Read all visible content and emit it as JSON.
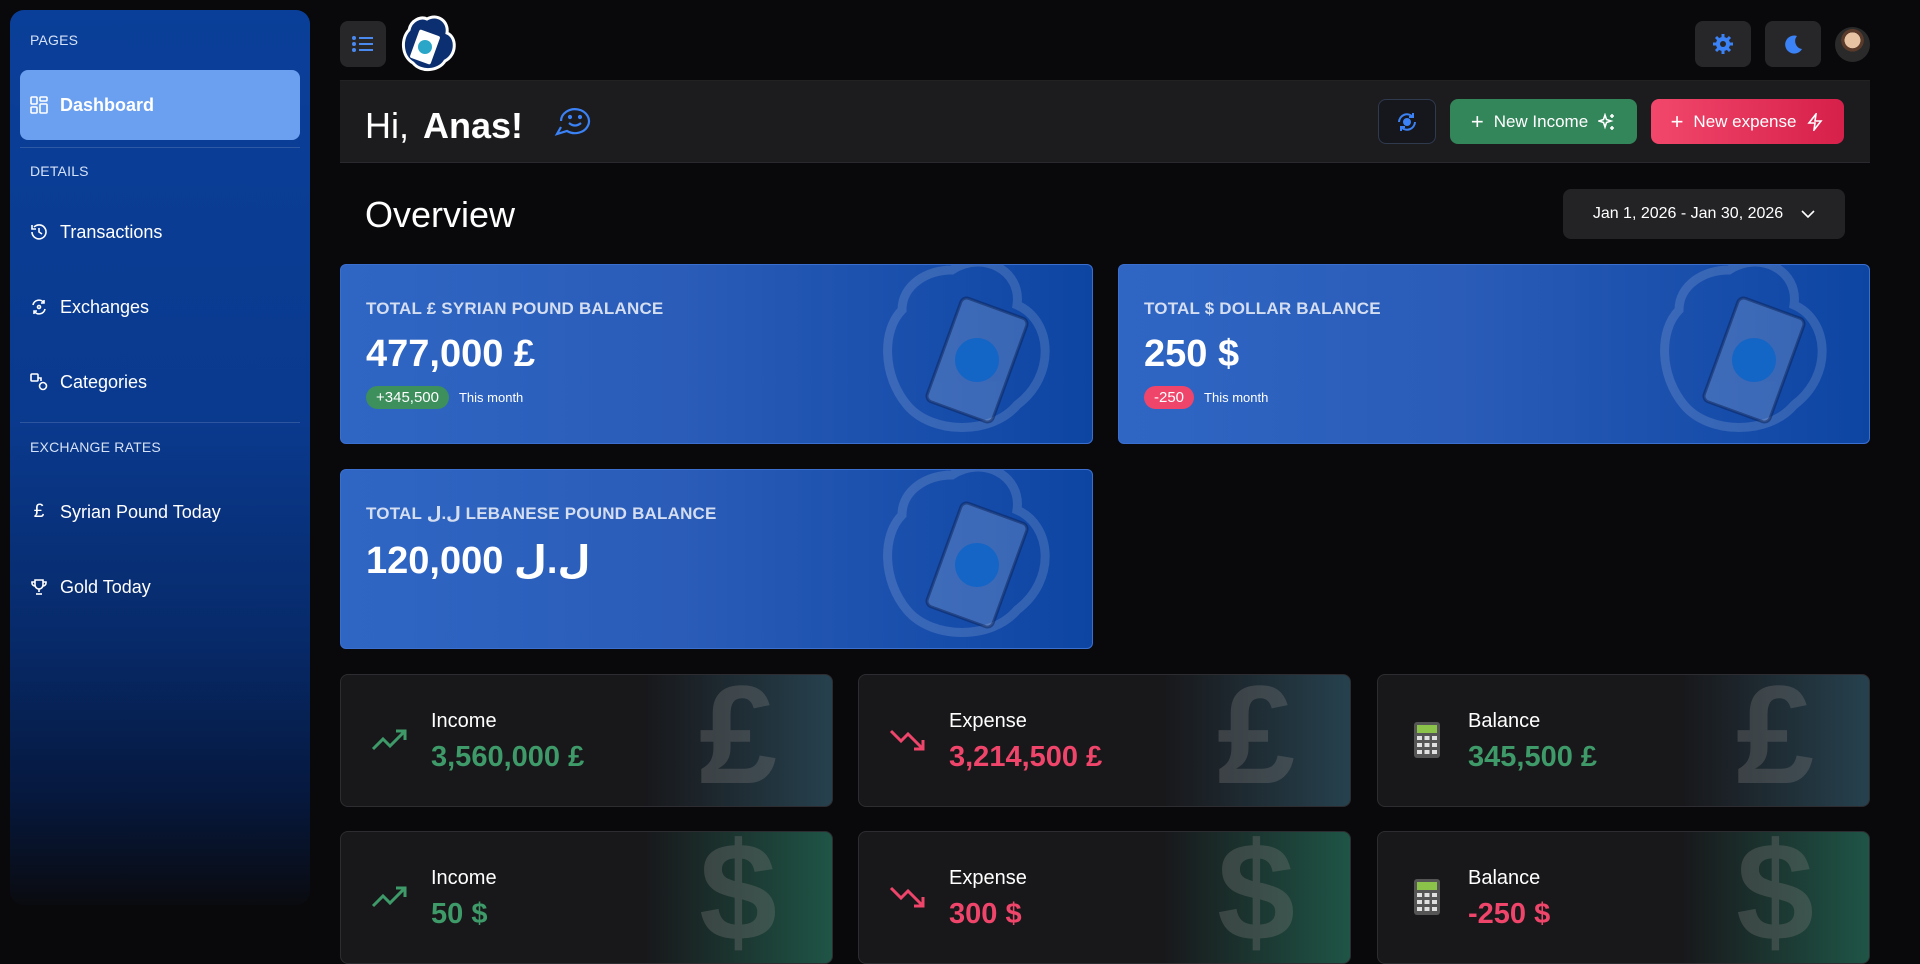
{
  "sidebar": {
    "sections": [
      "PAGES",
      "DETAILS",
      "EXCHANGE RATES"
    ],
    "items": [
      {
        "label": "Dashboard",
        "icon": "dashboard-icon"
      },
      {
        "label": "Transactions",
        "icon": "history-icon"
      },
      {
        "label": "Exchanges",
        "icon": "exchange-icon"
      },
      {
        "label": "Categories",
        "icon": "categories-icon"
      },
      {
        "label": "Syrian Pound Today",
        "icon": "pound-icon"
      },
      {
        "label": "Gold Today",
        "icon": "trophy-icon"
      }
    ]
  },
  "header": {
    "hi": "Hi,",
    "name": "Anas!",
    "new_income": "New Income",
    "new_expense": "New expense"
  },
  "overview": {
    "title": "Overview",
    "date_range": "Jan 1, 2026 - Jan 30, 2026"
  },
  "balances": [
    {
      "title": "TOTAL £ SYRIAN POUND BALANCE",
      "value": "477,000 £",
      "delta": "+345,500",
      "delta_note": "This month"
    },
    {
      "title": "TOTAL $ DOLLAR BALANCE",
      "value": "250 $",
      "delta": "-250",
      "delta_note": "This month"
    },
    {
      "title": "TOTAL ل.ل LEBANESE POUND BALANCE",
      "value": "120,000 ل.ل"
    }
  ],
  "stats_syp": [
    {
      "label": "Income",
      "value": "3,560,000 £"
    },
    {
      "label": "Expense",
      "value": "3,214,500 £"
    },
    {
      "label": "Balance",
      "value": "345,500 £"
    }
  ],
  "stats_usd": [
    {
      "label": "Income",
      "value": "50 $"
    },
    {
      "label": "Expense",
      "value": "300 $"
    },
    {
      "label": "Balance",
      "value": "-250 $"
    }
  ],
  "symbols": {
    "pound": "£",
    "dollar": "$"
  },
  "colors": {
    "accent": "#3b82f6",
    "income": "#3e9a68",
    "expense": "#f0456a"
  }
}
